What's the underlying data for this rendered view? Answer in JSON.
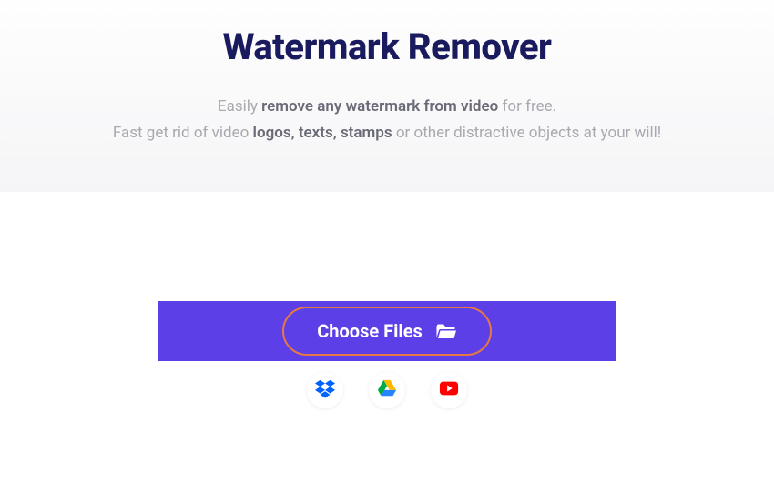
{
  "hero": {
    "title": "Watermark Remover",
    "line1_pre": "Easily ",
    "line1_bold": "remove any watermark from video",
    "line1_post": " for free.",
    "line2_pre": "Fast get rid of video ",
    "line2_bold": "logos, texts, stamps",
    "line2_post": " or other distractive objects at your will!"
  },
  "upload": {
    "choose_files_label": "Choose Files"
  },
  "cloud_sources": {
    "dropbox": "Dropbox",
    "google_drive": "Google Drive",
    "youtube": "YouTube"
  },
  "colors": {
    "primary": "#5d3fe8",
    "accent_border": "#e67843",
    "title": "#1a1a5e"
  }
}
